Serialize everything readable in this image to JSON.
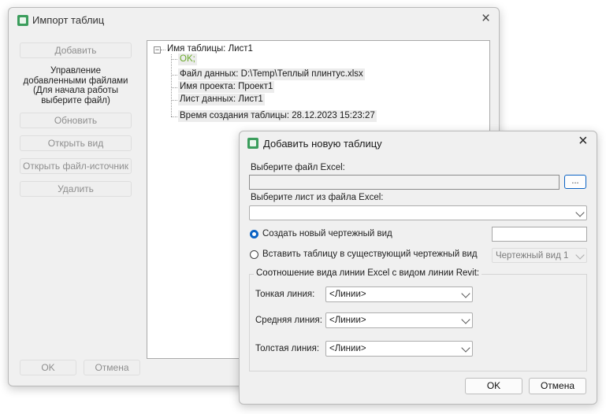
{
  "import_window": {
    "title": "Импорт таблиц",
    "buttons": {
      "add": "Добавить",
      "refresh": "Обновить",
      "open_view": "Открыть вид",
      "open_source": "Открыть файл-источник",
      "delete": "Удалить",
      "ok": "OK",
      "cancel": "Отмена"
    },
    "hint": [
      "Управление",
      "добавленными файлами",
      "(Для начала работы",
      "выберите файл)"
    ],
    "tree": {
      "root": "Имя таблицы: Лист1",
      "expander": "−",
      "children": [
        "OK;",
        "Файл данных: D:\\Temp\\Теплый плинтус.xlsx",
        "Имя проекта: Проект1",
        "Лист данных: Лист1",
        "Время создания таблицы: 28.12.2023 15:23:27"
      ]
    },
    "status_color": "#6aaa2a"
  },
  "add_dialog": {
    "title": "Добавить новую таблицу",
    "excel_file_label": "Выберите файл Excel:",
    "excel_file_value": "",
    "browse_label": "...",
    "sheet_label": "Выберите лист из файла Excel:",
    "sheet_value": "",
    "radio_new": "Создать новый чертежный вид",
    "radio_new_selected": true,
    "new_view_name": "",
    "radio_existing": "Вставить таблицу в существующий чертежный вид",
    "existing_view_value": "Чертежный вид 1",
    "group_title": "Соотношение вида линии Excel с видом линии Revit:",
    "thin_label": "Тонкая линия:",
    "thin_value": "<Линии>",
    "medium_label": "Средняя линия:",
    "medium_value": "<Линии>",
    "thick_label": "Толстая линия:",
    "thick_value": "<Линии>",
    "ok": "OK",
    "cancel": "Отмена"
  },
  "icons": {
    "close": "×",
    "app": "table-import-icon"
  },
  "accent": "#0b63c4"
}
